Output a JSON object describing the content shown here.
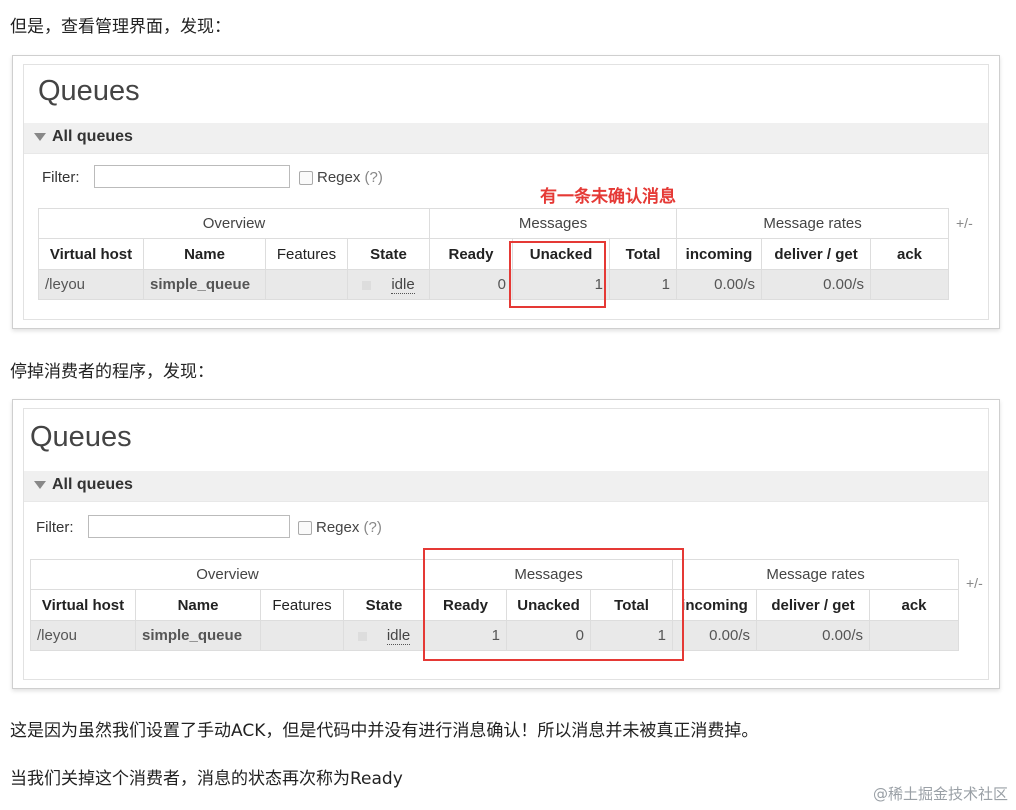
{
  "article": {
    "p1": "但是，查看管理界面，发现：",
    "p2": "停掉消费者的程序，发现：",
    "p3": "这是因为虽然我们设置了手动ACK，但是代码中并没有进行消息确认！所以消息并未被真正消费掉。",
    "p4": "当我们关掉这个消费者，消息的状态再次称为Ready"
  },
  "annotation": "有一条未确认消息",
  "watermark": "@稀土掘金技术社区",
  "colors": {
    "annotation_red": "#e53935",
    "row_bg": "#e9e9e9",
    "section_bar": "#f0f0f0"
  },
  "screenshot1": {
    "title": "Queues",
    "section": "All queues",
    "filter_label": "Filter:",
    "filter_value": "",
    "regex_label": "Regex",
    "regex_hint": "(?)",
    "plus_minus": "+/-",
    "groups": [
      "Overview",
      "Messages",
      "Message rates"
    ],
    "headers": [
      "Virtual host",
      "Name",
      "Features",
      "State",
      "Ready",
      "Unacked",
      "Total",
      "incoming",
      "deliver / get",
      "ack"
    ],
    "row": {
      "vhost": "/leyou",
      "name": "simple_queue",
      "features": "",
      "state": "idle",
      "ready": "0",
      "unacked": "1",
      "total": "1",
      "incoming": "0.00/s",
      "deliver": "0.00/s",
      "ack": ""
    }
  },
  "screenshot2": {
    "title": "Queues",
    "section": "All queues",
    "filter_label": "Filter:",
    "filter_value": "",
    "regex_label": "Regex",
    "regex_hint": "(?)",
    "plus_minus": "+/-",
    "groups": [
      "Overview",
      "Messages",
      "Message rates"
    ],
    "headers": [
      "Virtual host",
      "Name",
      "Features",
      "State",
      "Ready",
      "Unacked",
      "Total",
      "incoming",
      "deliver / get",
      "ack"
    ],
    "row": {
      "vhost": "/leyou",
      "name": "simple_queue",
      "features": "",
      "state": "idle",
      "ready": "1",
      "unacked": "0",
      "total": "1",
      "incoming": "0.00/s",
      "deliver": "0.00/s",
      "ack": ""
    }
  }
}
